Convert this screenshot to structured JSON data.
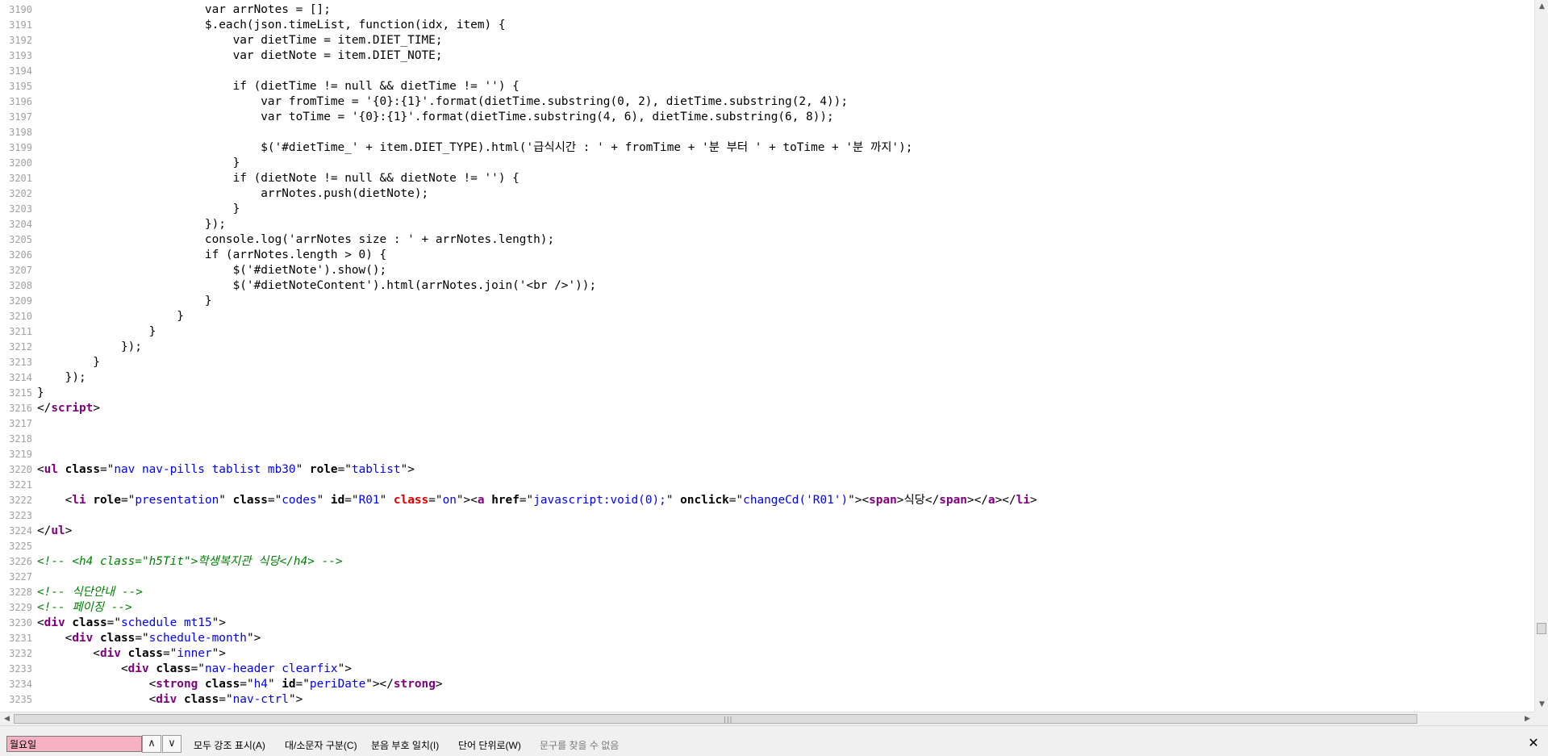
{
  "viewer": {
    "lines": [
      {
        "n": "3190",
        "tokens": [
          {
            "c": "plain",
            "t": "                        var arrNotes = [];"
          }
        ]
      },
      {
        "n": "3191",
        "tokens": [
          {
            "c": "plain",
            "t": "                        $.each(json.timeList, function(idx, item) {"
          }
        ]
      },
      {
        "n": "3192",
        "tokens": [
          {
            "c": "plain",
            "t": "                            var dietTime = item.DIET_TIME;"
          }
        ]
      },
      {
        "n": "3193",
        "tokens": [
          {
            "c": "plain",
            "t": "                            var dietNote = item.DIET_NOTE;"
          }
        ]
      },
      {
        "n": "3194",
        "tokens": []
      },
      {
        "n": "3195",
        "tokens": [
          {
            "c": "plain",
            "t": "                            if (dietTime != null && dietTime != '') {"
          }
        ]
      },
      {
        "n": "3196",
        "tokens": [
          {
            "c": "plain",
            "t": "                                var fromTime = '{0}:{1}'.format(dietTime.substring(0, 2), dietTime.substring(2, 4));"
          }
        ]
      },
      {
        "n": "3197",
        "tokens": [
          {
            "c": "plain",
            "t": "                                var toTime = '{0}:{1}'.format(dietTime.substring(4, 6), dietTime.substring(6, 8));"
          }
        ]
      },
      {
        "n": "3198",
        "tokens": []
      },
      {
        "n": "3199",
        "tokens": [
          {
            "c": "plain",
            "t": "                                $('#dietTime_' + item.DIET_TYPE).html('급식시간 : ' + fromTime + '분 부터 ' + toTime + '분 까지');"
          }
        ]
      },
      {
        "n": "3200",
        "tokens": [
          {
            "c": "plain",
            "t": "                            }"
          }
        ]
      },
      {
        "n": "3201",
        "tokens": [
          {
            "c": "plain",
            "t": "                            if (dietNote != null && dietNote != '') {"
          }
        ]
      },
      {
        "n": "3202",
        "tokens": [
          {
            "c": "plain",
            "t": "                                arrNotes.push(dietNote);"
          }
        ]
      },
      {
        "n": "3203",
        "tokens": [
          {
            "c": "plain",
            "t": "                            }"
          }
        ]
      },
      {
        "n": "3204",
        "tokens": [
          {
            "c": "plain",
            "t": "                        });"
          }
        ]
      },
      {
        "n": "3205",
        "tokens": [
          {
            "c": "plain",
            "t": "                        console.log('arrNotes size : ' + arrNotes.length);"
          }
        ]
      },
      {
        "n": "3206",
        "tokens": [
          {
            "c": "plain",
            "t": "                        if (arrNotes.length > 0) {"
          }
        ]
      },
      {
        "n": "3207",
        "tokens": [
          {
            "c": "plain",
            "t": "                            $('#dietNote').show();"
          }
        ]
      },
      {
        "n": "3208",
        "tokens": [
          {
            "c": "plain",
            "t": "                            $('#dietNoteContent').html(arrNotes.join('<br />'));"
          }
        ]
      },
      {
        "n": "3209",
        "tokens": [
          {
            "c": "plain",
            "t": "                        }"
          }
        ]
      },
      {
        "n": "3210",
        "tokens": [
          {
            "c": "plain",
            "t": "                    }"
          }
        ]
      },
      {
        "n": "3211",
        "tokens": [
          {
            "c": "plain",
            "t": "                }"
          }
        ]
      },
      {
        "n": "3212",
        "tokens": [
          {
            "c": "plain",
            "t": "            });"
          }
        ]
      },
      {
        "n": "3213",
        "tokens": [
          {
            "c": "plain",
            "t": "        }"
          }
        ]
      },
      {
        "n": "3214",
        "tokens": [
          {
            "c": "plain",
            "t": "    });"
          }
        ]
      },
      {
        "n": "3215",
        "tokens": [
          {
            "c": "plain",
            "t": "}"
          }
        ]
      },
      {
        "n": "3216",
        "tokens": [
          {
            "c": "plain",
            "t": "</"
          },
          {
            "c": "tag",
            "t": "script"
          },
          {
            "c": "plain",
            "t": ">"
          }
        ]
      },
      {
        "n": "3217",
        "tokens": []
      },
      {
        "n": "3218",
        "tokens": []
      },
      {
        "n": "3219",
        "tokens": []
      },
      {
        "n": "3220",
        "tokens": [
          {
            "c": "plain",
            "t": "<"
          },
          {
            "c": "tag",
            "t": "ul"
          },
          {
            "c": "plain",
            "t": " "
          },
          {
            "c": "attr",
            "t": "class"
          },
          {
            "c": "plain",
            "t": "=\""
          },
          {
            "c": "val",
            "t": "nav nav-pills tablist mb30"
          },
          {
            "c": "plain",
            "t": "\" "
          },
          {
            "c": "attr",
            "t": "role"
          },
          {
            "c": "plain",
            "t": "=\""
          },
          {
            "c": "val",
            "t": "tablist"
          },
          {
            "c": "plain",
            "t": "\">"
          }
        ]
      },
      {
        "n": "3221",
        "tokens": []
      },
      {
        "n": "3222",
        "tokens": [
          {
            "c": "plain",
            "t": "    <"
          },
          {
            "c": "tag",
            "t": "li"
          },
          {
            "c": "plain",
            "t": " "
          },
          {
            "c": "attr",
            "t": "role"
          },
          {
            "c": "plain",
            "t": "=\""
          },
          {
            "c": "val",
            "t": "presentation"
          },
          {
            "c": "plain",
            "t": "\" "
          },
          {
            "c": "attr",
            "t": "class"
          },
          {
            "c": "plain",
            "t": "=\""
          },
          {
            "c": "val",
            "t": "codes"
          },
          {
            "c": "plain",
            "t": "\" "
          },
          {
            "c": "attr",
            "t": "id"
          },
          {
            "c": "plain",
            "t": "=\""
          },
          {
            "c": "val",
            "t": "R01"
          },
          {
            "c": "plain",
            "t": "\" "
          },
          {
            "c": "red",
            "t": "class"
          },
          {
            "c": "plain",
            "t": "=\""
          },
          {
            "c": "val",
            "t": "on"
          },
          {
            "c": "plain",
            "t": "\"><"
          },
          {
            "c": "tag",
            "t": "a"
          },
          {
            "c": "plain",
            "t": " "
          },
          {
            "c": "attr",
            "t": "href"
          },
          {
            "c": "plain",
            "t": "=\""
          },
          {
            "c": "val",
            "t": "javascript:void(0);"
          },
          {
            "c": "plain",
            "t": "\" "
          },
          {
            "c": "attr",
            "t": "onclick"
          },
          {
            "c": "plain",
            "t": "=\""
          },
          {
            "c": "val",
            "t": "changeCd('R01')"
          },
          {
            "c": "plain",
            "t": "\"><"
          },
          {
            "c": "tag",
            "t": "span"
          },
          {
            "c": "plain",
            "t": ">식당</"
          },
          {
            "c": "tag",
            "t": "span"
          },
          {
            "c": "plain",
            "t": "></"
          },
          {
            "c": "tag",
            "t": "a"
          },
          {
            "c": "plain",
            "t": "></"
          },
          {
            "c": "tag",
            "t": "li"
          },
          {
            "c": "plain",
            "t": ">"
          }
        ]
      },
      {
        "n": "3223",
        "tokens": []
      },
      {
        "n": "3224",
        "tokens": [
          {
            "c": "plain",
            "t": "</"
          },
          {
            "c": "tag",
            "t": "ul"
          },
          {
            "c": "plain",
            "t": ">"
          }
        ]
      },
      {
        "n": "3225",
        "tokens": []
      },
      {
        "n": "3226",
        "tokens": [
          {
            "c": "cmt",
            "t": "<!-- <h4 class=\"h5Tit\">학생복지관 식당</h4> -->"
          }
        ]
      },
      {
        "n": "3227",
        "tokens": []
      },
      {
        "n": "3228",
        "tokens": [
          {
            "c": "cmt",
            "t": "<!-- 식단안내 -->"
          }
        ]
      },
      {
        "n": "3229",
        "tokens": [
          {
            "c": "cmt",
            "t": "<!-- 페이징 -->"
          }
        ]
      },
      {
        "n": "3230",
        "tokens": [
          {
            "c": "plain",
            "t": "<"
          },
          {
            "c": "tag",
            "t": "div"
          },
          {
            "c": "plain",
            "t": " "
          },
          {
            "c": "attr",
            "t": "class"
          },
          {
            "c": "plain",
            "t": "=\""
          },
          {
            "c": "val",
            "t": "schedule mt15"
          },
          {
            "c": "plain",
            "t": "\">"
          }
        ]
      },
      {
        "n": "3231",
        "tokens": [
          {
            "c": "plain",
            "t": "    <"
          },
          {
            "c": "tag",
            "t": "div"
          },
          {
            "c": "plain",
            "t": " "
          },
          {
            "c": "attr",
            "t": "class"
          },
          {
            "c": "plain",
            "t": "=\""
          },
          {
            "c": "val",
            "t": "schedule-month"
          },
          {
            "c": "plain",
            "t": "\">"
          }
        ]
      },
      {
        "n": "3232",
        "tokens": [
          {
            "c": "plain",
            "t": "        <"
          },
          {
            "c": "tag",
            "t": "div"
          },
          {
            "c": "plain",
            "t": " "
          },
          {
            "c": "attr",
            "t": "class"
          },
          {
            "c": "plain",
            "t": "=\""
          },
          {
            "c": "val",
            "t": "inner"
          },
          {
            "c": "plain",
            "t": "\">"
          }
        ]
      },
      {
        "n": "3233",
        "tokens": [
          {
            "c": "plain",
            "t": "            <"
          },
          {
            "c": "tag",
            "t": "div"
          },
          {
            "c": "plain",
            "t": " "
          },
          {
            "c": "attr",
            "t": "class"
          },
          {
            "c": "plain",
            "t": "=\""
          },
          {
            "c": "val",
            "t": "nav-header clearfix"
          },
          {
            "c": "plain",
            "t": "\">"
          }
        ]
      },
      {
        "n": "3234",
        "tokens": [
          {
            "c": "plain",
            "t": "                <"
          },
          {
            "c": "tag",
            "t": "strong"
          },
          {
            "c": "plain",
            "t": " "
          },
          {
            "c": "attr",
            "t": "class"
          },
          {
            "c": "plain",
            "t": "=\""
          },
          {
            "c": "val",
            "t": "h4"
          },
          {
            "c": "plain",
            "t": "\" "
          },
          {
            "c": "attr",
            "t": "id"
          },
          {
            "c": "plain",
            "t": "=\""
          },
          {
            "c": "val",
            "t": "periDate"
          },
          {
            "c": "plain",
            "t": "\"></"
          },
          {
            "c": "tag",
            "t": "strong"
          },
          {
            "c": "plain",
            "t": ">"
          }
        ]
      },
      {
        "n": "3235",
        "tokens": [
          {
            "c": "plain",
            "t": "                <"
          },
          {
            "c": "tag",
            "t": "div"
          },
          {
            "c": "plain",
            "t": " "
          },
          {
            "c": "attr",
            "t": "class"
          },
          {
            "c": "plain",
            "t": "=\""
          },
          {
            "c": "val",
            "t": "nav-ctrl"
          },
          {
            "c": "plain",
            "t": "\">"
          }
        ]
      }
    ]
  },
  "scrollbar": {
    "up_icon": "▲",
    "down_icon": "▼",
    "left_icon": "◀",
    "right_icon": "▶",
    "grip": "|||"
  },
  "findbar": {
    "query": "월요일",
    "prev_icon": "∧",
    "next_icon": "∨",
    "highlight_all": "모두 강조 표시(A)",
    "match_case": "대/소문자 구분(C)",
    "match_diacritics": "분음 부호 일치(I)",
    "whole_words": "단어 단위로(W)",
    "status": "문구를 찾을 수 없음",
    "close_icon": "✕"
  },
  "colors": {
    "tag": "#800080",
    "attr": "#000000",
    "red_attr": "#e00000",
    "value": "#0000ff",
    "comment": "#008000",
    "line_number": "#a0a0a0",
    "find_input_notfound": "#f6b1c3"
  }
}
